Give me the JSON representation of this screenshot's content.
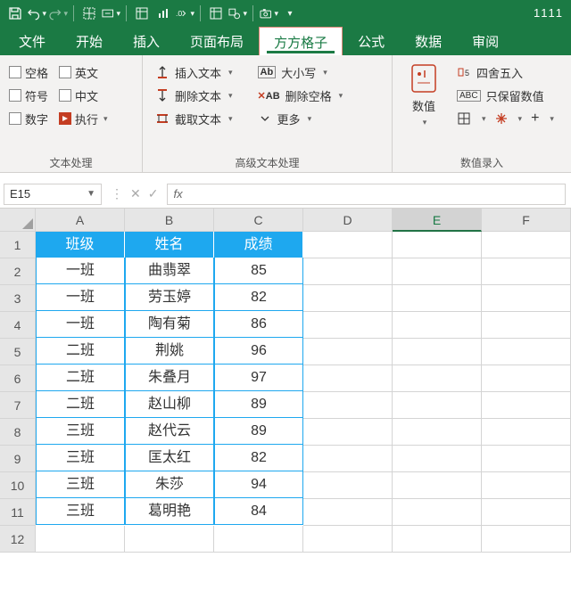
{
  "app": {
    "title": "1111"
  },
  "qat": {
    "items": [
      "save-icon",
      "undo-icon",
      "redo-icon",
      "sep",
      "merge1-icon",
      "merge2-icon",
      "sep",
      "table-icon",
      "chart-icon",
      "percent-icon",
      "sep",
      "freeze-icon",
      "shapes-icon",
      "sep",
      "camera-icon"
    ]
  },
  "tabs": {
    "items": [
      {
        "id": "file",
        "label": "文件"
      },
      {
        "id": "home",
        "label": "开始"
      },
      {
        "id": "insert",
        "label": "插入"
      },
      {
        "id": "pagelayout",
        "label": "页面布局"
      },
      {
        "id": "fanggezi",
        "label": "方方格子"
      },
      {
        "id": "formulas",
        "label": "公式"
      },
      {
        "id": "data",
        "label": "数据"
      },
      {
        "id": "review",
        "label": "审阅"
      }
    ],
    "active": "fanggezi"
  },
  "ribbon": {
    "groups": [
      {
        "id": "text-process",
        "label": "文本处理",
        "checks": [
          {
            "id": "space",
            "label": "空格"
          },
          {
            "id": "english",
            "label": "英文"
          },
          {
            "id": "symbol",
            "label": "符号"
          },
          {
            "id": "chinese",
            "label": "中文"
          },
          {
            "id": "number",
            "label": "数字"
          },
          {
            "id": "exec",
            "label": "执行",
            "exec": true
          }
        ]
      },
      {
        "id": "adv-text",
        "label": "高级文本处理",
        "left": [
          {
            "id": "insert-text",
            "label": "插入文本",
            "icon": "insert-text"
          },
          {
            "id": "delete-text",
            "label": "删除文本",
            "icon": "delete-text"
          },
          {
            "id": "cut-text",
            "label": "截取文本",
            "icon": "cut-text"
          }
        ],
        "right": [
          {
            "id": "case",
            "label": "大小写",
            "icon": "case"
          },
          {
            "id": "delete-space",
            "label": "删除空格",
            "icon": "delete-space"
          },
          {
            "id": "more",
            "label": "更多",
            "icon": "more"
          }
        ]
      },
      {
        "id": "num-entry",
        "label": "数值录入",
        "big": {
          "id": "num-value",
          "label": "数值"
        },
        "right": [
          {
            "id": "round",
            "label": "四舍五入",
            "icon": "round"
          },
          {
            "id": "keep-num",
            "label": "只保留数值",
            "icon": "keep-num"
          },
          {
            "id": "placeholder",
            "label": "",
            "icons": true
          }
        ]
      }
    ]
  },
  "namebox": {
    "value": "E15"
  },
  "formulabar": {
    "fx": "fx",
    "value": ""
  },
  "grid": {
    "cols": [
      "A",
      "B",
      "C",
      "D",
      "E",
      "F"
    ],
    "selected_col": "E",
    "selected_row": 15,
    "header": [
      "班级",
      "姓名",
      "成绩"
    ],
    "rows": [
      [
        "一班",
        "曲翡翠",
        "85"
      ],
      [
        "一班",
        "劳玉婷",
        "82"
      ],
      [
        "一班",
        "陶有菊",
        "86"
      ],
      [
        "二班",
        "荆姚",
        "96"
      ],
      [
        "二班",
        "朱叠月",
        "97"
      ],
      [
        "二班",
        "赵山柳",
        "89"
      ],
      [
        "三班",
        "赵代云",
        "89"
      ],
      [
        "三班",
        "匡太红",
        "82"
      ],
      [
        "三班",
        "朱莎",
        "94"
      ],
      [
        "三班",
        "葛明艳",
        "84"
      ]
    ],
    "total_rows": 12
  }
}
